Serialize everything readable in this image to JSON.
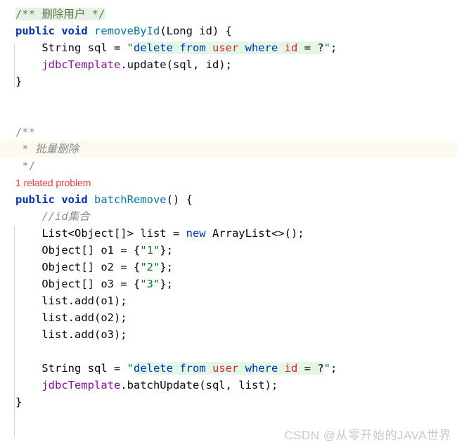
{
  "editor": {
    "background": "#ffffff",
    "caret_line_color": "#fcf9ee",
    "doc_highlight_color": "#e8f2e4",
    "sql_fragment_color": "#e4f7e7",
    "indent_guide_color": "#d8d8d8"
  },
  "colors": {
    "keyword": "#0033b3",
    "method": "#00779f",
    "field": "#871094",
    "string": "#067d17",
    "comment": "#8c8c8c",
    "sql_keyword": "#0033b3",
    "sql_identifier": "#d6272b",
    "error": "#ef3b3b",
    "text": "#080808"
  },
  "code": {
    "doc_comment_1": "/** 删除用户 */",
    "method1": {
      "modifier": "public",
      "return_type": "void",
      "name": "removeById",
      "params": "(Long id) {",
      "signature_prefix": "public void ",
      "signature_suffix": "(Long id) {",
      "close_brace": "}"
    },
    "sql_statement": {
      "prefix": "String sql = ",
      "open_quote": "\"",
      "kw1": "delete from ",
      "id1": "user",
      "kw2": " where ",
      "id2": "id",
      "op": " = ?",
      "close_quote": "\"",
      "suffix": ";"
    },
    "update_call": {
      "field": "jdbcTemplate",
      "rest": ".update(sql, id);"
    },
    "doc_block": {
      "open": "/**",
      "body": " * 批量删除",
      "close": " */"
    },
    "inlay_hint": "1 related problem",
    "method2": {
      "signature_prefix": "public void ",
      "name": "batchRemove",
      "signature_suffix": "() {",
      "close_brace": "}"
    },
    "comment_id_set": "//id集合",
    "list_decl": {
      "prefix": "List<Object[]> list = ",
      "keyword": "new",
      "suffix": " ArrayList<>();"
    },
    "obj1": {
      "prefix": "Object[] o1 = {",
      "value": "\"1\"",
      "suffix": "};"
    },
    "obj2": {
      "prefix": "Object[] o2 = {",
      "value": "\"2\"",
      "suffix": "};"
    },
    "obj3": {
      "prefix": "Object[] o3 = {",
      "value": "\"3\"",
      "suffix": "};"
    },
    "add1": "list.add(o1);",
    "add2": "list.add(o2);",
    "add3": "list.add(o3);",
    "batch_update_call": {
      "field": "jdbcTemplate",
      "rest": ".batchUpdate(sql, list);"
    }
  },
  "watermark": {
    "text": "CSDN @从零开始的JAVA世界"
  }
}
